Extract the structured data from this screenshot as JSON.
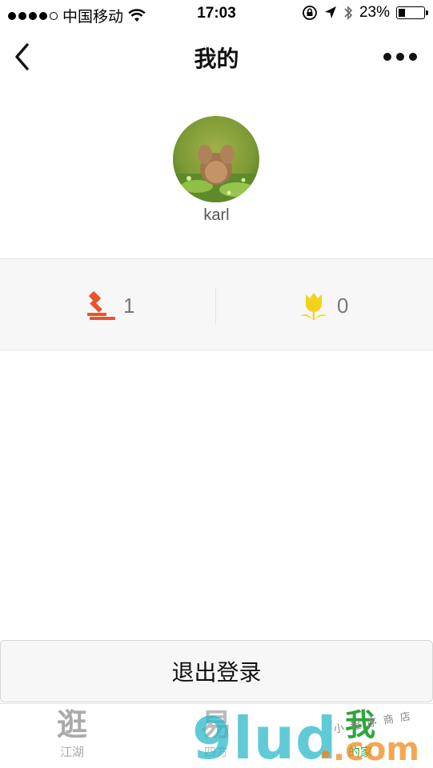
{
  "status_bar": {
    "carrier": "中国移动",
    "time": "17:03",
    "battery_percent": "23%",
    "battery_level": 0.23,
    "icons": [
      "signal-dots-icon",
      "wifi-icon",
      "rotation-lock-icon",
      "location-arrow-icon",
      "bluetooth-icon",
      "battery-icon"
    ]
  },
  "nav": {
    "title": "我的",
    "back_icon": "chevron-left-icon",
    "more_icon": "ellipsis-icon"
  },
  "profile": {
    "username": "karl"
  },
  "stats": [
    {
      "icon": "auction-hammer-icon",
      "value": "1",
      "color": "#e8552b"
    },
    {
      "icon": "tulip-icon",
      "value": "0",
      "color": "#f3d21b"
    }
  ],
  "logout": {
    "label": "退出登录"
  },
  "tabs": [
    {
      "glyph": "逛",
      "label": "江湖",
      "active": false
    },
    {
      "glyph": "易",
      "label": "四方",
      "active": false
    },
    {
      "glyph": "我",
      "label": "的家",
      "active": true
    }
  ],
  "watermark": {
    "main": "9lud",
    "suffix": ".com",
    "sub": "小程序商店"
  },
  "colors": {
    "active_tab": "#2aa63a",
    "inactive_tab": "#aaaaaa",
    "panel_bg": "#f7f7f7"
  }
}
